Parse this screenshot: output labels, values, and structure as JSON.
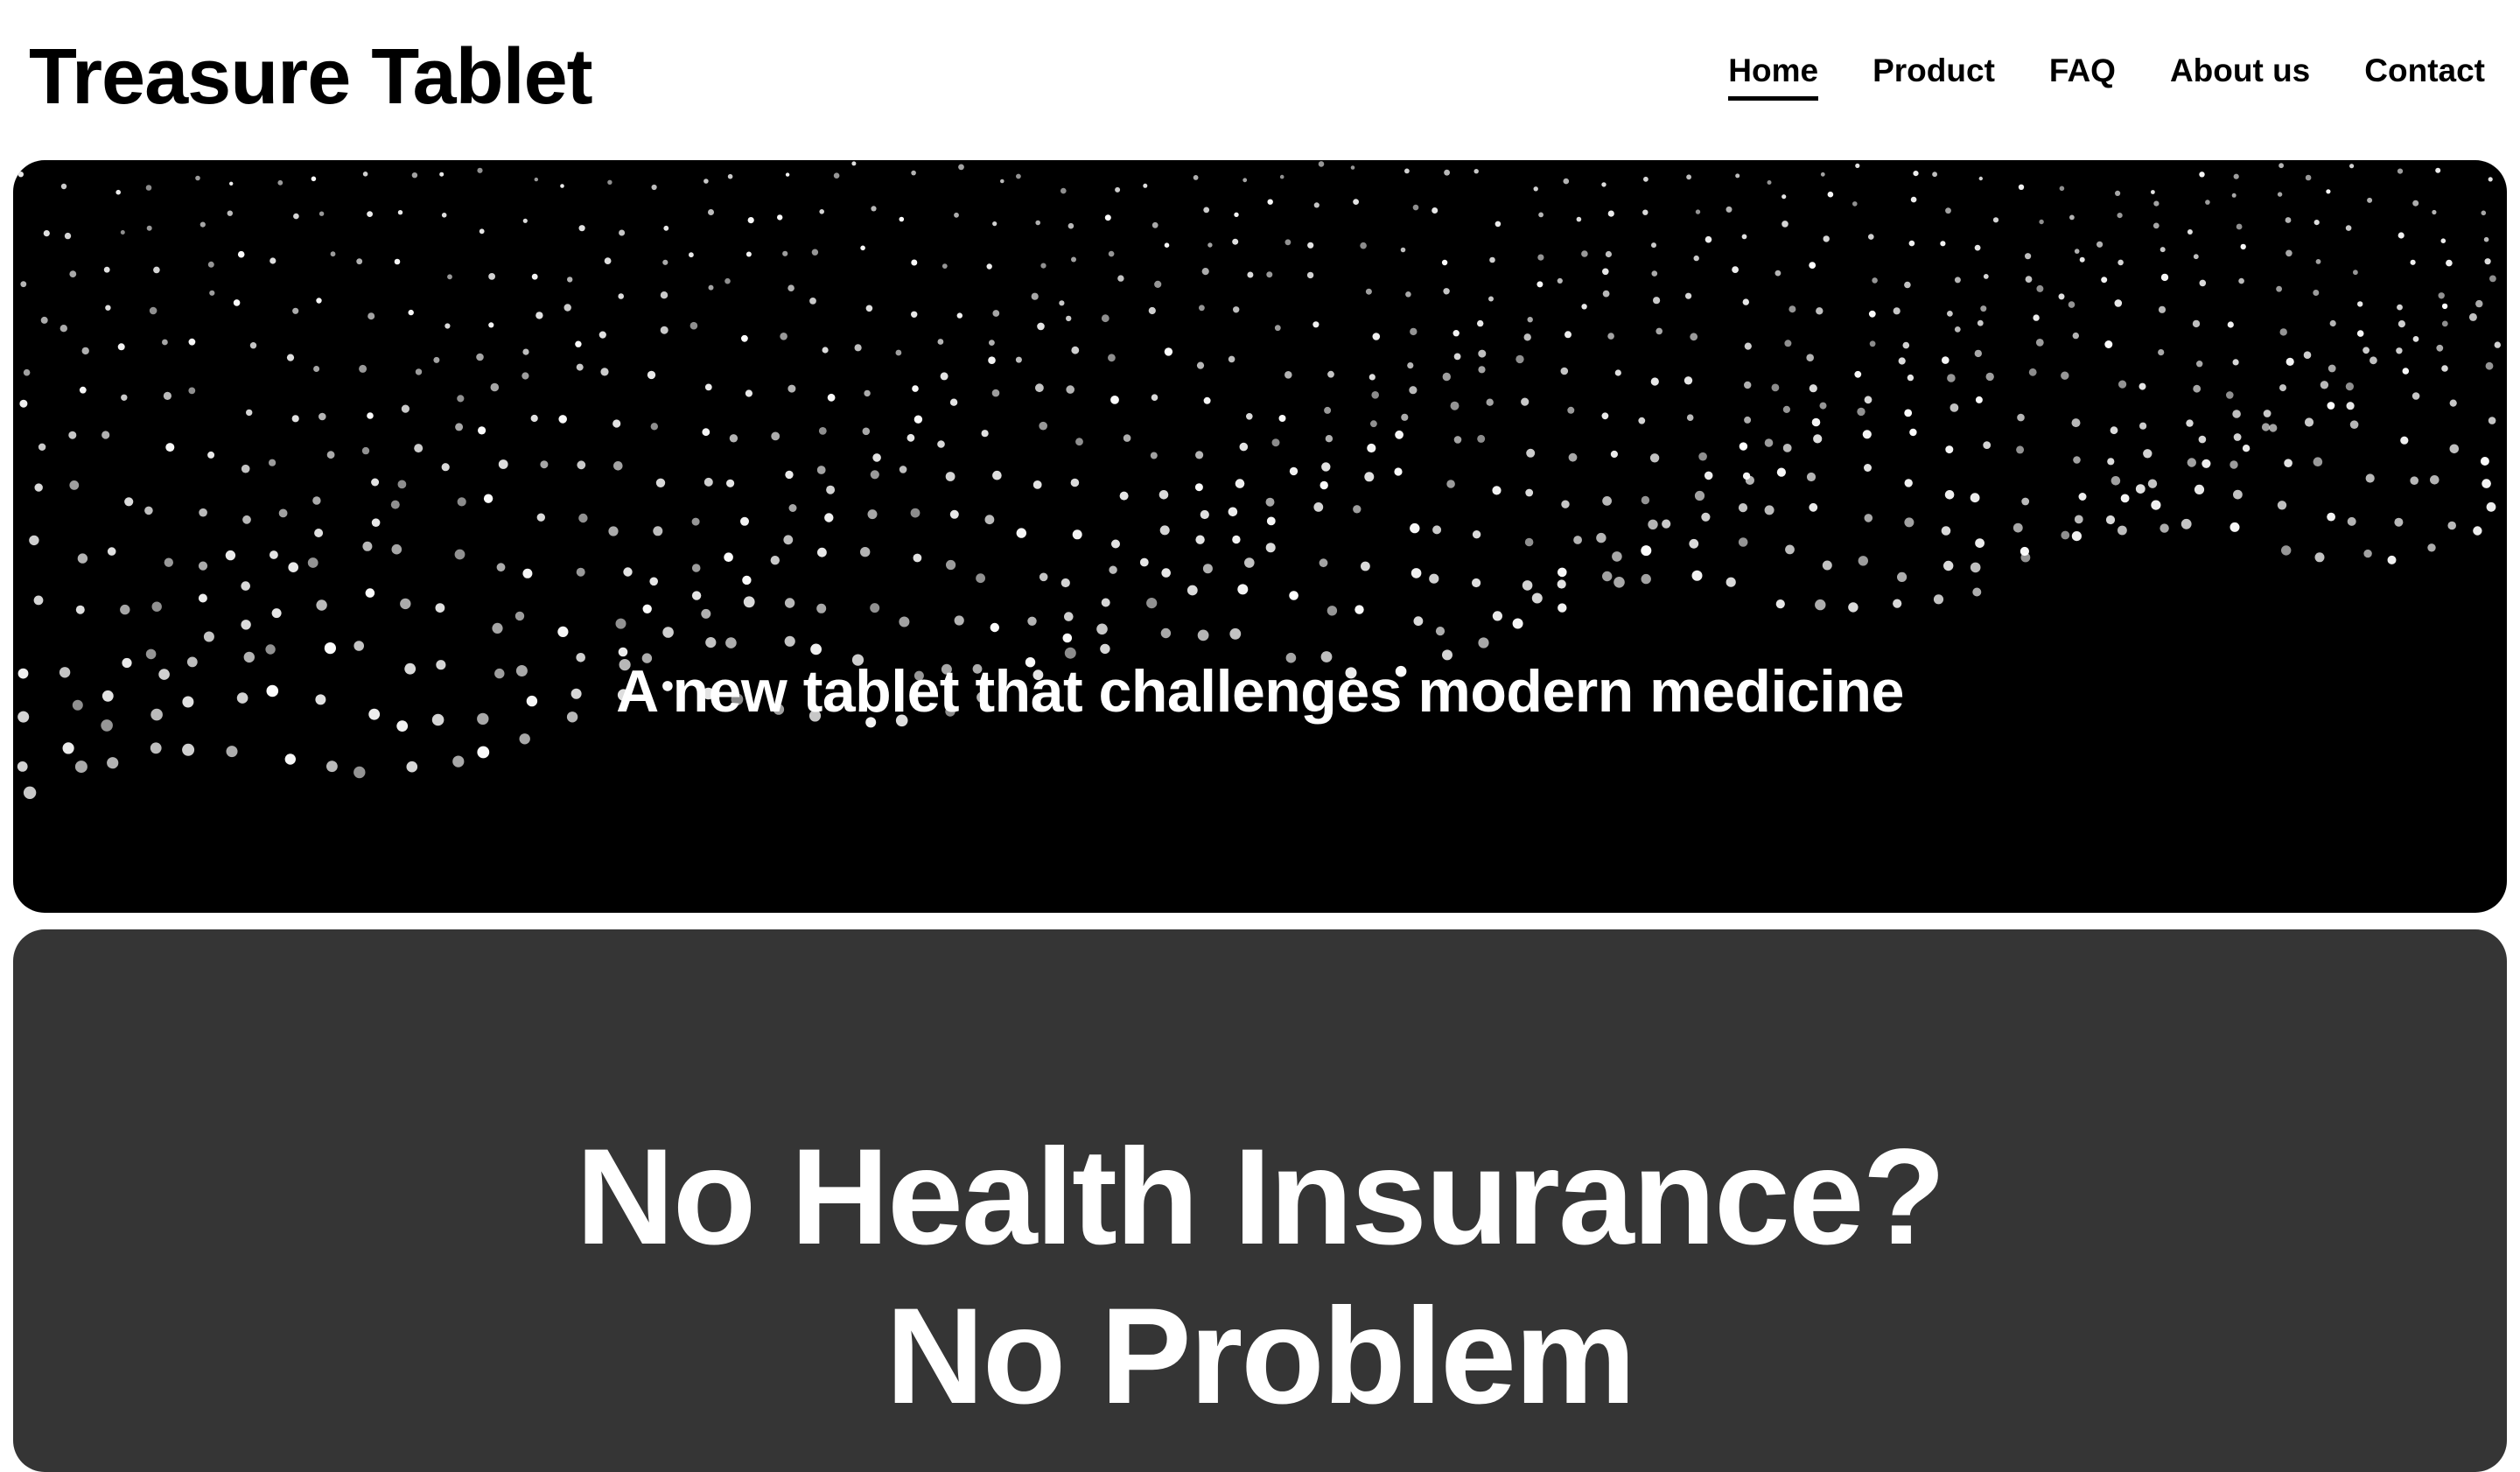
{
  "site": {
    "logo": "Treasure Tablet"
  },
  "nav": {
    "items": [
      {
        "label": "Home",
        "active": true
      },
      {
        "label": "Product",
        "active": false
      },
      {
        "label": "FAQ",
        "active": false
      },
      {
        "label": "About us",
        "active": false
      },
      {
        "label": "Contact",
        "active": false
      }
    ]
  },
  "hero": {
    "tagline": "A new tablet that challenges modern medicine",
    "background": "#000000",
    "particle_color": "#ffffff"
  },
  "promo": {
    "line1": "No Health Insurance?",
    "line2": "No Problem",
    "background": "#353535"
  }
}
